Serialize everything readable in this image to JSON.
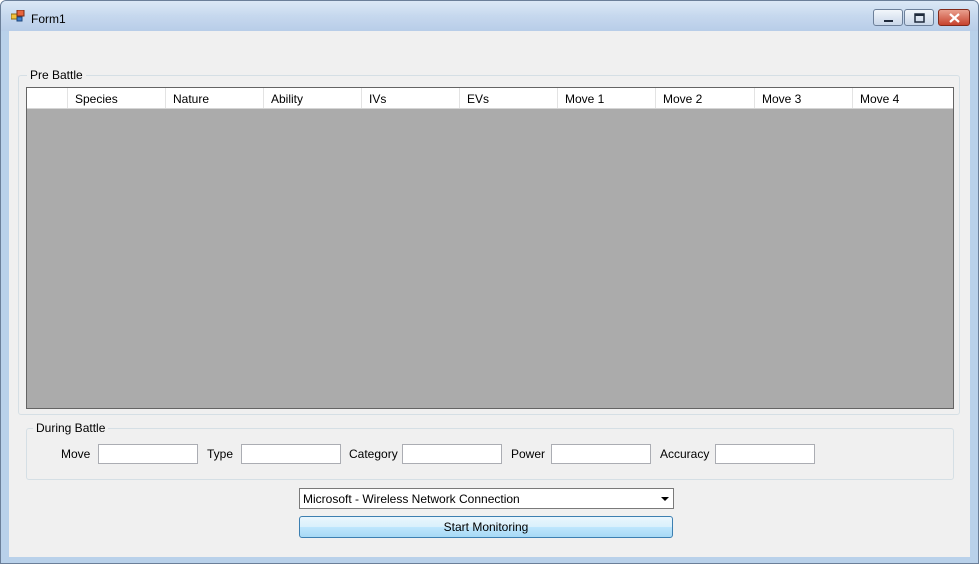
{
  "window": {
    "title": "Form1"
  },
  "pre_battle": {
    "group_label": "Pre Battle",
    "columns": [
      "Species",
      "Nature",
      "Ability",
      "IVs",
      "EVs",
      "Move 1",
      "Move 2",
      "Move 3",
      "Move 4"
    ]
  },
  "during_battle": {
    "group_label": "During Battle",
    "move_label": "Move",
    "type_label": "Type",
    "category_label": "Category",
    "power_label": "Power",
    "accuracy_label": "Accuracy"
  },
  "network": {
    "selected": "Microsoft - Wireless Network Connection"
  },
  "start_button": {
    "label": "Start Monitoring"
  },
  "colors": {
    "grid_background": "#ababab",
    "form_background": "#f0f0f0",
    "close_button": "#c7432e"
  }
}
